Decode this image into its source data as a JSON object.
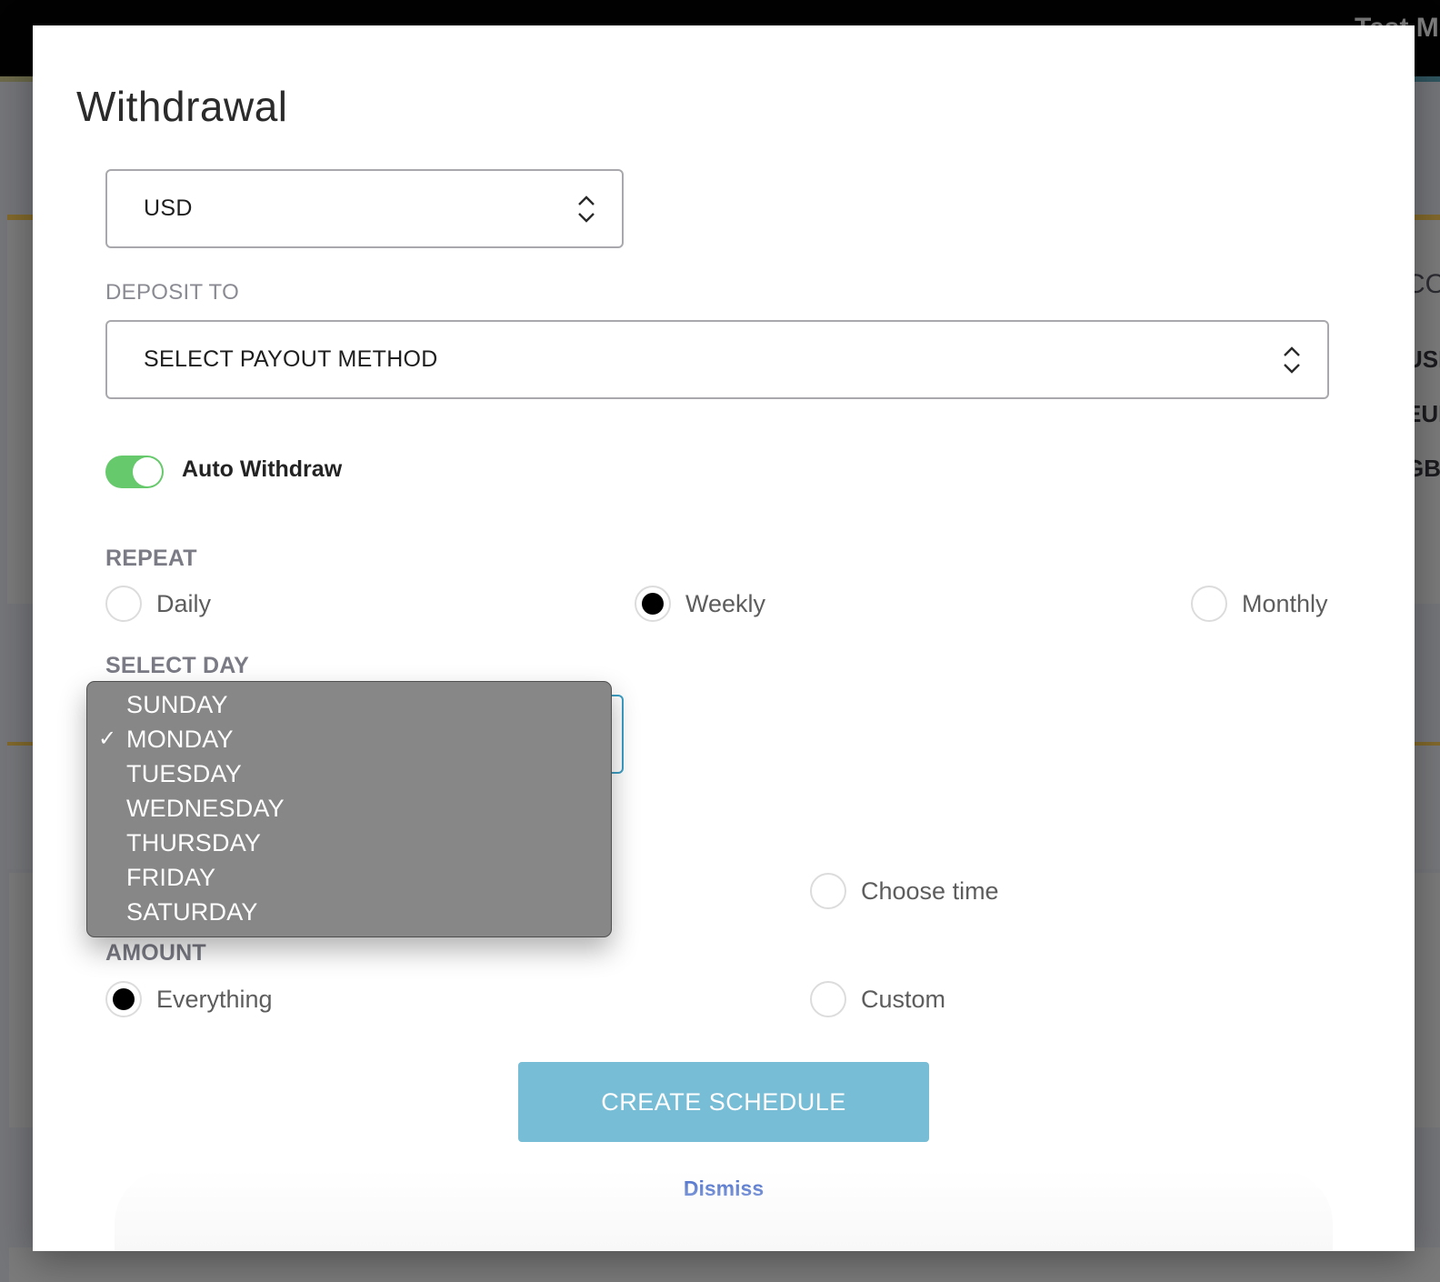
{
  "background": {
    "app_title_partial": "Test Mo",
    "section_heading_partial": "CO",
    "currency_rows_partial": [
      "USD",
      "EUR",
      "GBP"
    ]
  },
  "modal": {
    "title": "Withdrawal",
    "currency_select": {
      "value": "USD",
      "icon": "chevron-up-down-icon"
    },
    "deposit_to": {
      "label": "DEPOSIT TO",
      "placeholder": "SELECT PAYOUT METHOD",
      "icon": "chevron-up-down-icon"
    },
    "auto_withdraw": {
      "label": "Auto Withdraw",
      "enabled": true,
      "color": "#66c96b"
    },
    "repeat": {
      "label": "REPEAT",
      "options": [
        {
          "label": "Daily",
          "selected": false
        },
        {
          "label": "Weekly",
          "selected": true
        },
        {
          "label": "Monthly",
          "selected": false
        }
      ]
    },
    "select_day": {
      "label": "SELECT DAY",
      "selected": "MONDAY",
      "options": [
        "SUNDAY",
        "MONDAY",
        "TUESDAY",
        "WEDNESDAY",
        "THURSDAY",
        "FRIDAY",
        "SATURDAY"
      ],
      "check_glyph": "✓"
    },
    "time": {
      "options": [
        {
          "label": "Choose time",
          "selected": false
        }
      ]
    },
    "amount": {
      "label": "AMOUNT",
      "options": [
        {
          "label": "Everything",
          "selected": true
        },
        {
          "label": "Custom",
          "selected": false
        }
      ]
    },
    "create_button": {
      "label": "CREATE SCHEDULE",
      "color": "#77bdd6"
    },
    "dismiss_link": {
      "label": "Dismiss",
      "color": "#3d64c7"
    }
  }
}
